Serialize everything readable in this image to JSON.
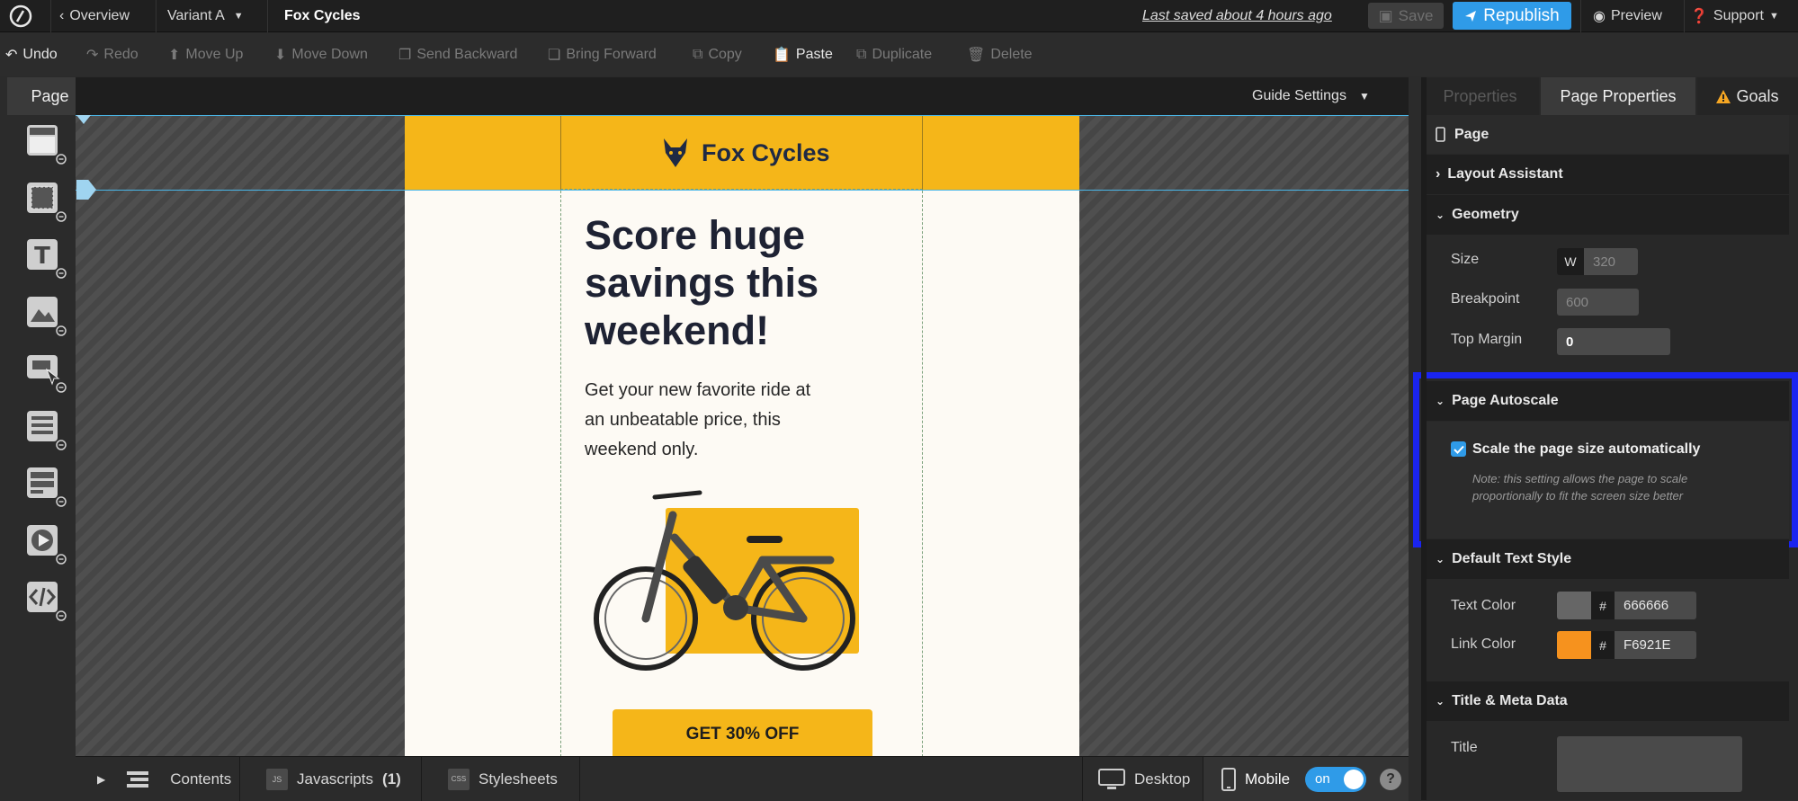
{
  "topbar": {
    "logo_icon": "circle-logo-icon",
    "overview": "Overview",
    "variant": "Variant A",
    "page_name": "Fox Cycles",
    "last_saved": "Last saved  about 4 hours ago",
    "save": "Save",
    "republish": "Republish",
    "preview": "Preview",
    "support": "Support"
  },
  "toolbar": {
    "undo": "Undo",
    "redo": "Redo",
    "move_up": "Move Up",
    "move_down": "Move Down",
    "send_backward": "Send Backward",
    "bring_forward": "Bring Forward",
    "copy": "Copy",
    "paste": "Paste",
    "duplicate": "Duplicate",
    "delete": "Delete"
  },
  "left": {
    "page_tab": "Page",
    "tools": [
      "section-icon",
      "box-icon",
      "text-icon",
      "image-icon",
      "button-icon",
      "form-icon",
      "list-icon",
      "video-icon",
      "code-icon"
    ]
  },
  "canvas": {
    "guide_settings": "Guide Settings",
    "brand": "Fox Cycles",
    "headline": [
      "Score huge",
      "savings this",
      "weekend!"
    ],
    "body": [
      "Get your new favorite ride at",
      "an unbeatable price, this",
      "weekend only."
    ],
    "cta": "GET 30% OFF"
  },
  "panel": {
    "tabs": [
      "Properties",
      "Page Properties",
      "Goals"
    ],
    "page_label": "Page",
    "sections": {
      "layout": "Layout Assistant",
      "geometry": "Geometry",
      "autoscale": "Page Autoscale",
      "text_style": "Default Text Style",
      "meta": "Title & Meta Data"
    },
    "geometry": {
      "size_label": "Size",
      "w": "W",
      "size_value": "320",
      "breakpoint_label": "Breakpoint",
      "breakpoint_value": "600",
      "top_margin_label": "Top Margin",
      "top_margin_value": "0"
    },
    "autoscale": {
      "checkbox_label": "Scale the page size automatically",
      "checked": true,
      "note_1": "Note: this setting allows the page to scale",
      "note_2": "proportionally to fit the screen size better"
    },
    "text_style": {
      "text_color_label": "Text Color",
      "text_color_value": "666666",
      "link_color_label": "Link Color",
      "link_color_value": "F6921E",
      "hash": "#"
    },
    "meta": {
      "title_label": "Title"
    }
  },
  "bottom": {
    "contents": "Contents",
    "javascripts": "Javascripts",
    "js_count": "(1)",
    "js_badge": "JS",
    "stylesheets": "Stylesheets",
    "css_badge": "CSS",
    "desktop": "Desktop",
    "mobile": "Mobile",
    "toggle": "on",
    "help": "?"
  },
  "colors": {
    "accent_blue": "#2f9be8",
    "brand_yellow": "#f5b619",
    "highlight_frame": "#1a24f0",
    "text_color": "#666666",
    "link_color": "#F6921E"
  }
}
